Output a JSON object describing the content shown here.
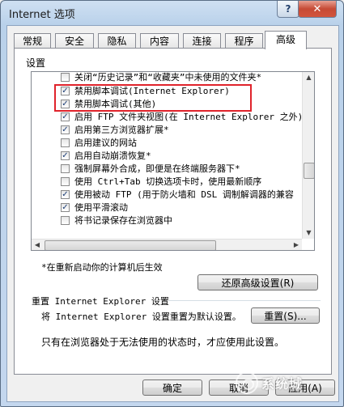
{
  "window": {
    "title": "Internet 选项",
    "help_label": "?",
    "close_label": "✕"
  },
  "tabs": [
    {
      "label": "常规"
    },
    {
      "label": "安全"
    },
    {
      "label": "隐私"
    },
    {
      "label": "内容"
    },
    {
      "label": "连接"
    },
    {
      "label": "程序"
    },
    {
      "label": "高级",
      "active": true
    }
  ],
  "settings": {
    "group_label": "设置",
    "items": [
      {
        "label": "关闭“历史记录”和“收藏夹”中未使用的文件夹*",
        "checked": false
      },
      {
        "label": "禁用脚本调试(Internet Explorer)",
        "checked": true
      },
      {
        "label": "禁用脚本调试(其他)",
        "checked": true
      },
      {
        "label": "启用 FTP 文件夹视图(在 Internet Explorer 之外)",
        "checked": true
      },
      {
        "label": "启用第三方浏览器扩展*",
        "checked": true
      },
      {
        "label": "启用建议的网站",
        "checked": false
      },
      {
        "label": "启用自动崩溃恢复*",
        "checked": true
      },
      {
        "label": "强制屏幕外合成，即便是在终端服务器下*",
        "checked": false
      },
      {
        "label": "使用 Ctrl+Tab 切换选项卡时，使用最新顺序",
        "checked": false
      },
      {
        "label": "使用被动 FTP (用于防火墙和 DSL 调制解调器的兼容",
        "checked": true
      },
      {
        "label": "使用平滑滚动",
        "checked": true
      },
      {
        "label": "将书记录保存在浏览器中",
        "checked": false
      }
    ],
    "restart_note": "*在重新启动你的计算机后生效",
    "restore_button": "还原高级设置(R)"
  },
  "reset": {
    "section_title": "重置 Internet Explorer 设置",
    "description": "将 Internet Explorer 设置重置为默认设置。",
    "button": "重置(S)...",
    "note": "只有在浏览器处于无法使用的状态时，才应使用此设置。"
  },
  "footer": {
    "ok": "确定",
    "cancel": "取消",
    "apply": "应用(A)"
  },
  "watermark": {
    "text": "系统城"
  }
}
